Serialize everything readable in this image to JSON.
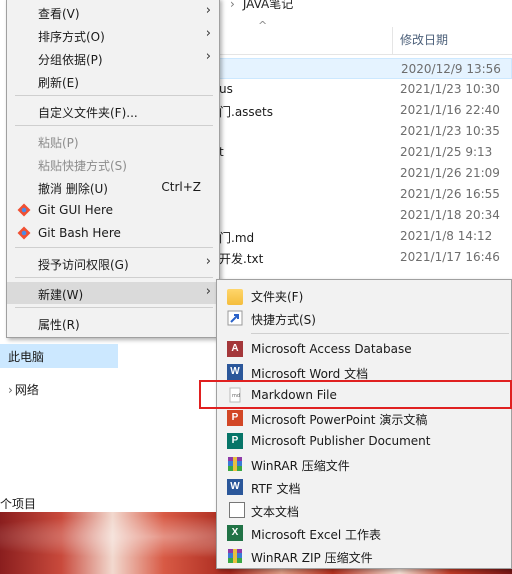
{
  "explorer": {
    "breadcrumb": "JAVA笔记",
    "column_header": "修改日期",
    "files": [
      {
        "name": "",
        "date": "2020/12/9 13:56",
        "selected": true
      },
      {
        "name": "us",
        "date": "2021/1/23 10:30"
      },
      {
        "name": "门.assets",
        "date": "2021/1/16 22:40"
      },
      {
        "name": "",
        "date": "2021/1/23 10:35"
      },
      {
        "name": "t",
        "date": "2021/1/25 9:13"
      },
      {
        "name": "",
        "date": "2021/1/26 21:09"
      },
      {
        "name": "",
        "date": "2021/1/26 16:55"
      },
      {
        "name": "",
        "date": "2021/1/18 20:34"
      },
      {
        "name": "门.md",
        "date": "2021/1/8 14:12"
      },
      {
        "name": "开发.txt",
        "date": "2021/1/17 16:46"
      }
    ],
    "nav_this_pc": "此电脑",
    "nav_network": "网络",
    "item_count": "个项目"
  },
  "context_menu": {
    "view": "查看(V)",
    "sort": "排序方式(O)",
    "group": "分组依据(P)",
    "refresh": "刷新(E)",
    "customize": "自定义文件夹(F)...",
    "paste": "粘贴(P)",
    "paste_shortcut": "粘贴快捷方式(S)",
    "undo_delete": "撤消 删除(U)",
    "undo_shortcut": "Ctrl+Z",
    "git_gui": "Git GUI Here",
    "git_bash": "Git Bash Here",
    "grant_access": "授予访问权限(G)",
    "new": "新建(W)",
    "properties": "属性(R)"
  },
  "new_submenu": {
    "folder": "文件夹(F)",
    "shortcut": "快捷方式(S)",
    "access_db": "Microsoft Access Database",
    "word_doc": "Microsoft Word 文档",
    "markdown": "Markdown File",
    "powerpoint": "Microsoft PowerPoint 演示文稿",
    "publisher": "Microsoft Publisher Document",
    "winrar": "WinRAR 压缩文件",
    "rtf": "RTF 文档",
    "text": "文本文档",
    "excel": "Microsoft Excel 工作表",
    "winrar_zip": "WinRAR ZIP 压缩文件"
  },
  "colors": {
    "highlight_box": "#e02020",
    "selection": "#cce8ff",
    "menu_bg": "#f2f2f2"
  }
}
